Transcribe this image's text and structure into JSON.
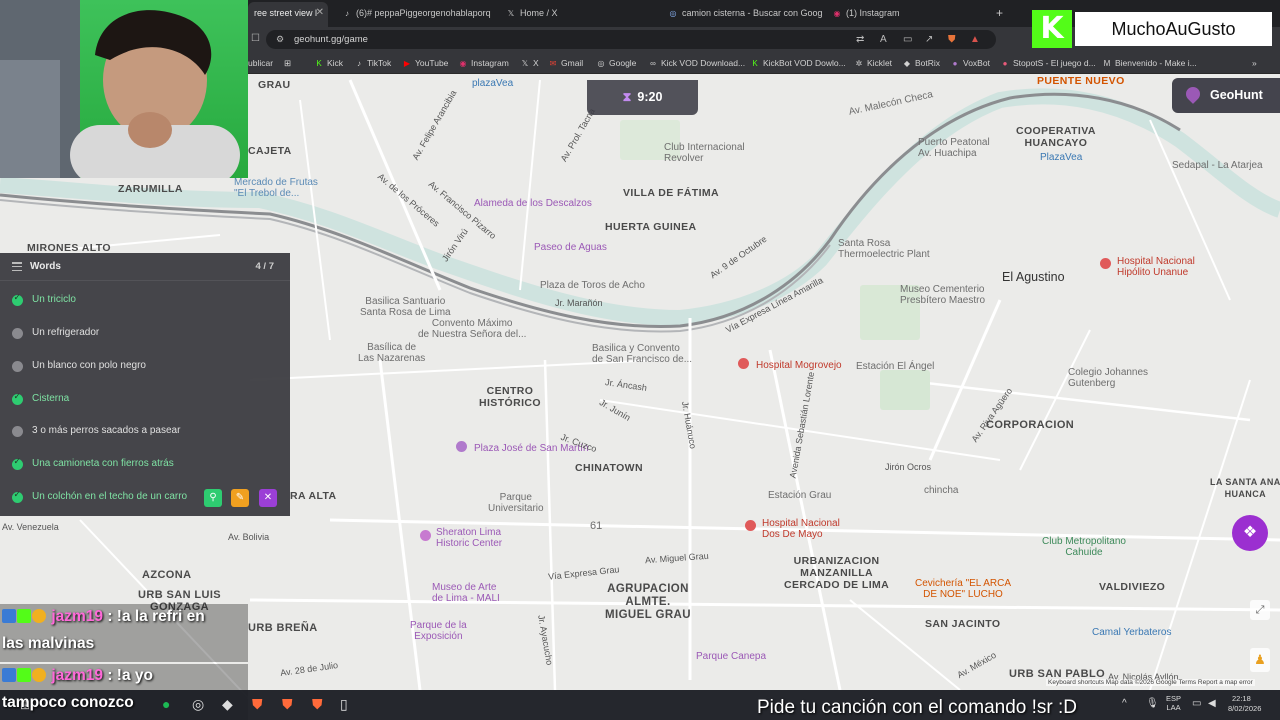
{
  "browser": {
    "tabs": [
      {
        "label": "ree street view l",
        "icon": "dot-icon"
      },
      {
        "label": "(6)# peppaPiggeorgenohablaporq",
        "icon": "tiktok-icon"
      },
      {
        "label": "Home / X",
        "icon": "x-icon"
      },
      {
        "label": "camion cisterna - Buscar con Google",
        "icon": "google-icon"
      },
      {
        "label": "(1) Instagram",
        "icon": "instagram-icon"
      }
    ],
    "new_tab": "+",
    "url": "geohunt.gg/game",
    "bookmarks": [
      "ublicar",
      "Kick",
      "TikTok",
      "YouTube",
      "Instagram",
      "X",
      "Gmail",
      "Google",
      "Kick VOD Download...",
      "KickBot VOD Dowlo...",
      "Kicklet",
      "BotRix",
      "VoxBot",
      "StopotS - El juego d...",
      "Bienvenido - Make i..."
    ]
  },
  "overlay": {
    "kick_letter": "K",
    "channel_name": "MuchoAuGusto",
    "timer": "9:20",
    "brand": "GeoHunt"
  },
  "words": {
    "title": "Words",
    "count": "4 / 7",
    "items": [
      {
        "label": "Un triciclo",
        "done": true
      },
      {
        "label": "Un refrigerador",
        "done": false
      },
      {
        "label": "Un blanco con polo negro",
        "done": false
      },
      {
        "label": "Cisterna",
        "done": true
      },
      {
        "label": "3 o más perros sacados a pasear",
        "done": false
      },
      {
        "label": "Una camioneta con fierros atrás",
        "done": true
      },
      {
        "label": "Un colchón en el techo de un carro",
        "done": true
      }
    ]
  },
  "map": {
    "labels": {
      "vf": "VILLA DE FÁTIMA",
      "hg": "HUERTA GUINEA",
      "ch": "CENTRO\nHISTÓRICO",
      "ct": "CHINATOWN",
      "ag": "AGRUPACION\nALMTE.\nMIGUEL GRAU",
      "um": "URBANIZACION\nMANZANILLA\nCERCADO DE LIMA",
      "corp": "CORPORACION",
      "elag": "El Agustino",
      "coop": "COOPERATIVA\nHUANCAYO",
      "azc": "AZCONA",
      "usl": "URB SAN LUIS\nGONZAGA",
      "ub": "URB BREÑA",
      "sj": "SAN JACINTO",
      "usp": "URB SAN PABLO",
      "valdi": "VALDIVIEZO",
      "zar": "ZARUMILLA",
      "ca": "CAJETA",
      "ma": "MIRONES ALTO",
      "ra": "RA ALTA",
      "grau": "GRAU",
      "pn": "PUENTE NUEVO",
      "santa_ana": "LA SANTA ANA\nHUANCA",
      "alameda": "Alameda de los Descalzos",
      "paseo": "Paseo de Aguas",
      "toros": "Plaza de Toros de Acho",
      "basilica1": "Basilica Santuario\nSanta Rosa de Lima",
      "convento": "Convento Máximo\nde Nuestra Señora del...",
      "basilica2": "Basilica y Convento\nde San Francisco de...",
      "nazarenas": "Basílica de\nLas Nazarenas",
      "hosp_mog": "Hospital Mogrovejo",
      "angel": "Estación El Ángel",
      "museo_cem": "Museo Cementerio\nPresbítero Maestro",
      "santa_rosa": "Santa Rosa\nThermoelectric Plant",
      "club": "Club Internacional\nRevolver",
      "plazavea": "plazaVea",
      "hosp_hip": "Hospital Nacional\nHipólito Unanue",
      "colegio": "Colegio Johannes\nGutenberg",
      "plaza_jm": "Plaza José de San Martín",
      "parque_u": "Parque\nUniversitario",
      "sheraton": "Sheraton Lima\nHistoric Center",
      "museo_arte": "Museo de Arte\nde Lima - MALI",
      "parque_exp": "Parque de la\nExposición",
      "parque_can": "Parque Canepa",
      "estacion_grau": "Estación Grau",
      "hosp_dos": "Hospital Nacional\nDos De Mayo",
      "club_met": "Club Metropolitano\nCahuide",
      "cevicheria": "Cevichería \"EL ARCA\nDE NOE\" LUCHO",
      "camal": "Camal Yerbateros",
      "mercado": "Mercado de Frutas\n\"El Trebol de...",
      "china": "chincha",
      "sedapal": "Sedapal - La Atarjea",
      "plazavea2": "PlazaVea",
      "puerto": "Puerto Peatonal\nAv. Huachipa",
      "huancayo2": "Av. Malecón Checa",
      "n61": "61",
      "av_plaza": "Avenida Sebastián Lorente",
      "jr_ancash": "Jr. Áncash",
      "jr_junin": "Jr. Junín",
      "jr_maranon": "Jr. Marañón",
      "via_exp": "Vía Expresa Línea Amarilla",
      "av_grau": "Av. Miguel Grau",
      "via_exp_grau": "Vía Expresa Grau",
      "av_28": "Av. 28 de Julio",
      "av_bolivia": "Av. Bolivia",
      "av_vzla": "Av. Venezuela",
      "av_9oct": "Av. 9 de Octubre",
      "av_riva": "Av. Riva Agüero",
      "jiron_ocros": "Jirón Ocros",
      "av_amezaga": "Av. Nicolás Ayllón",
      "av_mexico": "Av. México",
      "fa": "Av. Felipe Arancibia",
      "av_tacna": "Av. Prol. Tacna",
      "jr_huanuco": "Jr. Huánuco",
      "jiron_viru": "Jirón Virú",
      "av_los_proceres": "Av. de los Próceres",
      "av_fcopiz": "Av. Francisco Pizarro",
      "jr_cuzco": "Jr. Cuzco",
      "jr_ayacucho": "Jr. Ayacucho"
    },
    "attribution": "Keyboard shortcuts   Map data ©2026 Google   Terms   Report a map error"
  },
  "chat": {
    "lines": [
      {
        "user": "jazm19",
        "message": " : !a la refri en"
      },
      {
        "message": "las malvinas"
      },
      {
        "user": "jazm19",
        "message": " : !a yo"
      },
      {
        "message": "tampoco conozco"
      }
    ]
  },
  "ticker": "Pide tu canción con el comando !sr :D",
  "taskbar": {
    "lang": "ESP\nLAA",
    "time": "22:18",
    "date": "8/02/2026"
  },
  "colors": {
    "accent_purple": "#9b59b6",
    "done_green": "#2ecc71",
    "kick_green": "#53fc18"
  }
}
